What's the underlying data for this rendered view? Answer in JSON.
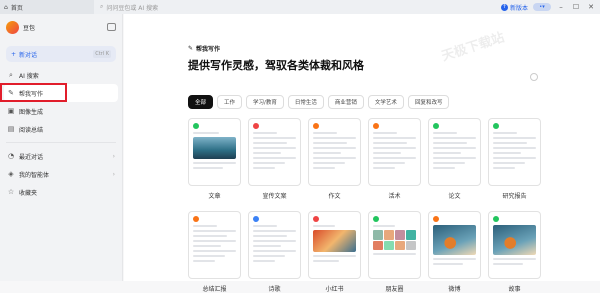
{
  "topbar": {
    "tab_label": "首页",
    "search_placeholder": "问问豆包或 AI 搜索",
    "new_version": "新版本"
  },
  "sidebar": {
    "user_name": "豆包",
    "new_chat_label": "新对话",
    "new_chat_shortcut": "Ctrl K",
    "items": [
      {
        "label": "AI 搜索",
        "icon": "search-icon"
      },
      {
        "label": "帮我写作",
        "icon": "pen-icon",
        "active": true
      },
      {
        "label": "图像生成",
        "icon": "image-icon"
      },
      {
        "label": "阅读总结",
        "icon": "book-icon"
      }
    ],
    "items2": [
      {
        "label": "最近对话",
        "icon": "clock-icon"
      },
      {
        "label": "我的智能体",
        "icon": "bot-icon"
      },
      {
        "label": "收藏夹",
        "icon": "star-icon"
      }
    ]
  },
  "main": {
    "kicker": "帮我写作",
    "headline": "提供写作灵感，驾驭各类体裁和风格",
    "watermark": "天极下载站",
    "chips": [
      "全部",
      "工作",
      "学习/教育",
      "日常生活",
      "商业营销",
      "文学艺术",
      "回复和改写"
    ],
    "cards": [
      {
        "label": "文章",
        "color": "#22c55e",
        "style": "sea"
      },
      {
        "label": "宣传文案",
        "color": "#ef4444",
        "style": "lines"
      },
      {
        "label": "作文",
        "color": "#f97316",
        "style": "text"
      },
      {
        "label": "活术",
        "color": "#f97316",
        "style": "text"
      },
      {
        "label": "论文",
        "color": "#22c55e",
        "style": "text"
      },
      {
        "label": "研究报告",
        "color": "#22c55e",
        "style": "text"
      },
      {
        "label": "总结汇报",
        "color": "#f97316",
        "style": "text"
      },
      {
        "label": "诗歌",
        "color": "#3b82f6",
        "style": "text"
      },
      {
        "label": "小红书",
        "color": "#ef4444",
        "style": "warm"
      },
      {
        "label": "朋友圈",
        "color": "#22c55e",
        "style": "grid"
      },
      {
        "label": "微博",
        "color": "#f97316",
        "style": "ink"
      },
      {
        "label": "故事",
        "color": "#22c55e",
        "style": "ink"
      }
    ]
  }
}
